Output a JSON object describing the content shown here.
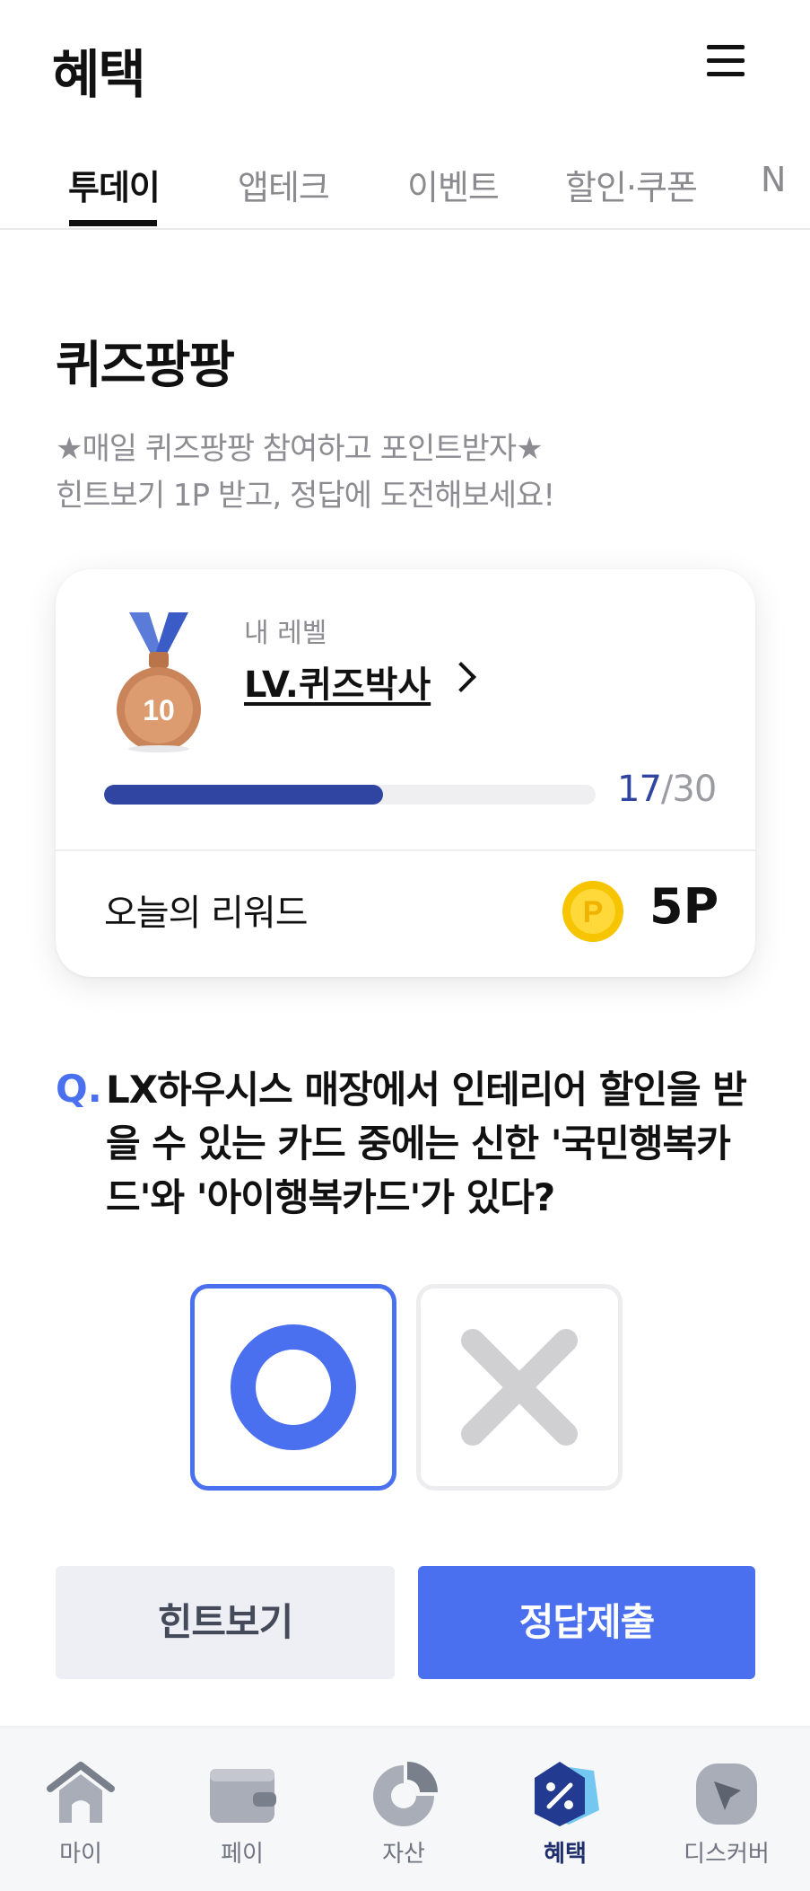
{
  "header": {
    "title": "혜택",
    "menu_icon": "hamburger-menu-icon"
  },
  "tabs": [
    {
      "label": "투데이",
      "active": true
    },
    {
      "label": "앱테크",
      "active": false
    },
    {
      "label": "이벤트",
      "active": false
    },
    {
      "label": "할인·쿠폰",
      "active": false
    },
    {
      "label": "N",
      "active": false
    }
  ],
  "quiz": {
    "title": "퀴즈팡팡",
    "desc_line1": "★매일 퀴즈팡팡 참여하고 포인트받자★",
    "desc_line2": "힌트보기 1P 받고, 정답에 도전해보세요!"
  },
  "level_card": {
    "caption": "내 레벨",
    "level_name": "LV.퀴즈박사",
    "medal_number": "10",
    "progress_current": "17",
    "progress_total": "/30",
    "progress_fraction": 0.5667,
    "reward_label": "오늘의 리워드",
    "reward_value": "5P",
    "coin_letter": "P"
  },
  "question": {
    "mark": "Q.",
    "text": "LX하우시스 매장에서 인테리어 할인을 받을 수 있는 카드 중에는 신한 '국민행복카드'와 '아이행복카드'가 있다?"
  },
  "answers": {
    "o_selected": true,
    "x_selected": false
  },
  "actions": {
    "hint_label": "힌트보기",
    "submit_label": "정답제출"
  },
  "bottom_nav": [
    {
      "label": "마이",
      "icon": "home-icon",
      "active": false
    },
    {
      "label": "페이",
      "icon": "wallet-icon",
      "active": false
    },
    {
      "label": "자산",
      "icon": "pie-chart-icon",
      "active": false
    },
    {
      "label": "혜택",
      "icon": "discount-tag-icon",
      "active": true
    },
    {
      "label": "디스커버",
      "icon": "compass-icon",
      "active": false
    }
  ],
  "colors": {
    "accent": "#4a70f0",
    "navy": "#2f45a1",
    "coin": "#f7c400"
  }
}
